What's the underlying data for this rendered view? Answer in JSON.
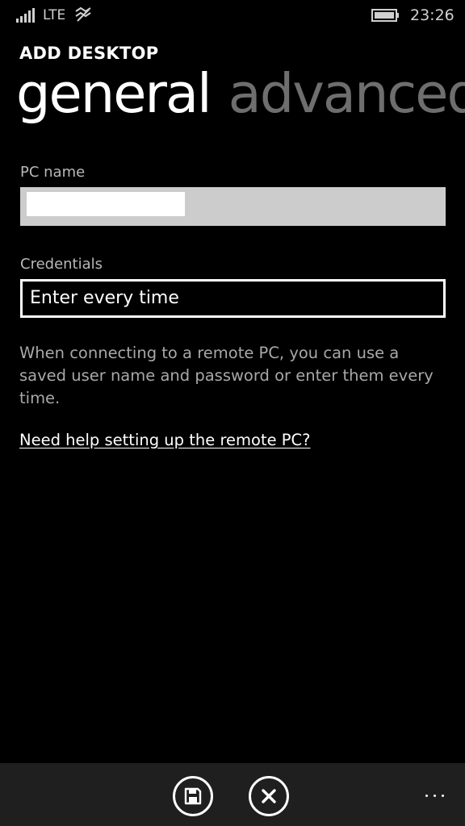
{
  "status_bar": {
    "network": "LTE",
    "time": "23:26",
    "signal_icon": "signal-bars-icon",
    "data_icon": "data-sense-icon",
    "battery_icon": "battery-icon"
  },
  "header": {
    "app_title": "ADD DESKTOP",
    "tabs": [
      {
        "label": "general",
        "active": true
      },
      {
        "label": "advanced",
        "active": false
      }
    ]
  },
  "form": {
    "pc_name": {
      "label": "PC name",
      "value": ""
    },
    "credentials": {
      "label": "Credentials",
      "value": "Enter every time"
    },
    "description": "When connecting to a remote PC, you can use a saved user name and password or enter them every time.",
    "help_link": "Need help setting up the remote PC?"
  },
  "app_bar": {
    "buttons": [
      {
        "icon": "save-icon"
      },
      {
        "icon": "cancel-icon"
      }
    ],
    "more_icon": "ellipsis-icon"
  },
  "colors": {
    "background": "#000000",
    "app_bar": "#1f1f1f",
    "inactive_tab": "#6e6e6e",
    "input_fill": "#cccccc"
  }
}
